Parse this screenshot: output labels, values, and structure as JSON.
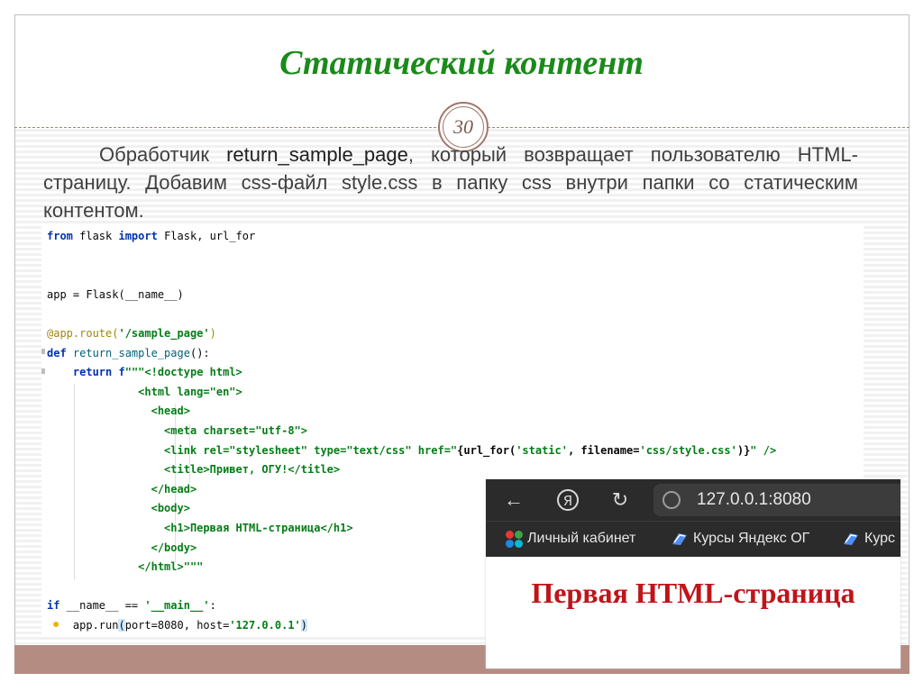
{
  "slide": {
    "title": "Статический контент",
    "page_number": "30"
  },
  "paragraph": {
    "part1": "Обработчик ",
    "handler": "return_sample_page",
    "part2": ", который возвращает пользователю HTML-страницу. Добавим css-файл style.css в папку css внутри папки со статическим контентом."
  },
  "code": {
    "l1": {
      "kw_from": "from",
      "mod": " flask ",
      "kw_import": "import",
      "names": " Flask, url_for"
    },
    "l4": {
      "text": "app = Flask(__name__)"
    },
    "l6": {
      "deco": "@app.route(",
      "str": "'/sample_page'",
      "close": ")"
    },
    "l7": {
      "kw": "def",
      "fn": " return_sample_page",
      "rest": "():"
    },
    "l8": {
      "kw": "return",
      "prefix": " f",
      "str": "\"\"\"<!doctype html>"
    },
    "l9": {
      "text": "<html lang=\"en\">"
    },
    "l10": {
      "text": "<head>"
    },
    "l11": {
      "text": "<meta charset=\"utf-8\">"
    },
    "l12": {
      "a": "<link rel=\"stylesheet\" type=\"text/css\" href=\"",
      "b": "{url_for(",
      "c": "'static'",
      "d": ", filename=",
      "e": "'css/style.css'",
      "f": ")}",
      "g": "\" />"
    },
    "l13": {
      "text": "<title>Привет, ОГУ!</title>"
    },
    "l14": {
      "text": "</head>"
    },
    "l15": {
      "text": "<body>"
    },
    "l16": {
      "text": "<h1>Первая HTML-страница</h1>"
    },
    "l17": {
      "text": "</body>"
    },
    "l18": {
      "text": "</html>\"\"\""
    },
    "l20": {
      "kw": "if",
      "mid": " __name__ == ",
      "str": "'__main__'",
      "end": ":"
    },
    "l21": {
      "a": "app.run",
      "b": "(",
      "c": "port=8080, host=",
      "d": "'127.0.0.1'",
      "e": ")"
    }
  },
  "browser": {
    "address": "127.0.0.1:8080",
    "bookmarks": [
      "Личный кабинет",
      "Курсы Яндекс ОГ",
      "Курс"
    ],
    "page_heading": "Первая HTML-страница",
    "icons": [
      "back-arrow-icon",
      "yandex-icon",
      "reload-icon",
      "globe-icon"
    ]
  },
  "colors": {
    "title_green": "#1a8a1a",
    "heading_red": "#c0141a",
    "accent_brown": "#b48c82"
  }
}
